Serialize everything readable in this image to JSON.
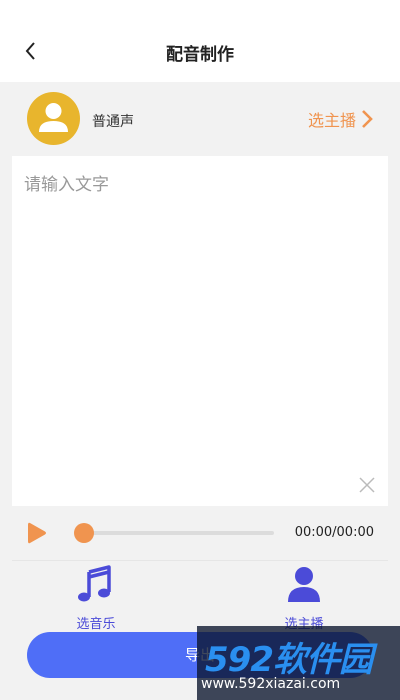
{
  "header": {
    "title": "配音制作",
    "back_icon": "chevron-left-icon"
  },
  "voice": {
    "name": "普通声",
    "choose_label": "选主播",
    "avatar_color": "#e8b52d",
    "accent": "#f0944f"
  },
  "editor": {
    "placeholder": "请输入文字",
    "value": ""
  },
  "player": {
    "time": "00:00/00:00",
    "progress": 0
  },
  "tools": {
    "music_label": "选音乐",
    "anchor_label": "选主播"
  },
  "export": {
    "label": "导出"
  },
  "watermark": {
    "logo": "592软件园",
    "url": "www.592xiazai.com"
  }
}
